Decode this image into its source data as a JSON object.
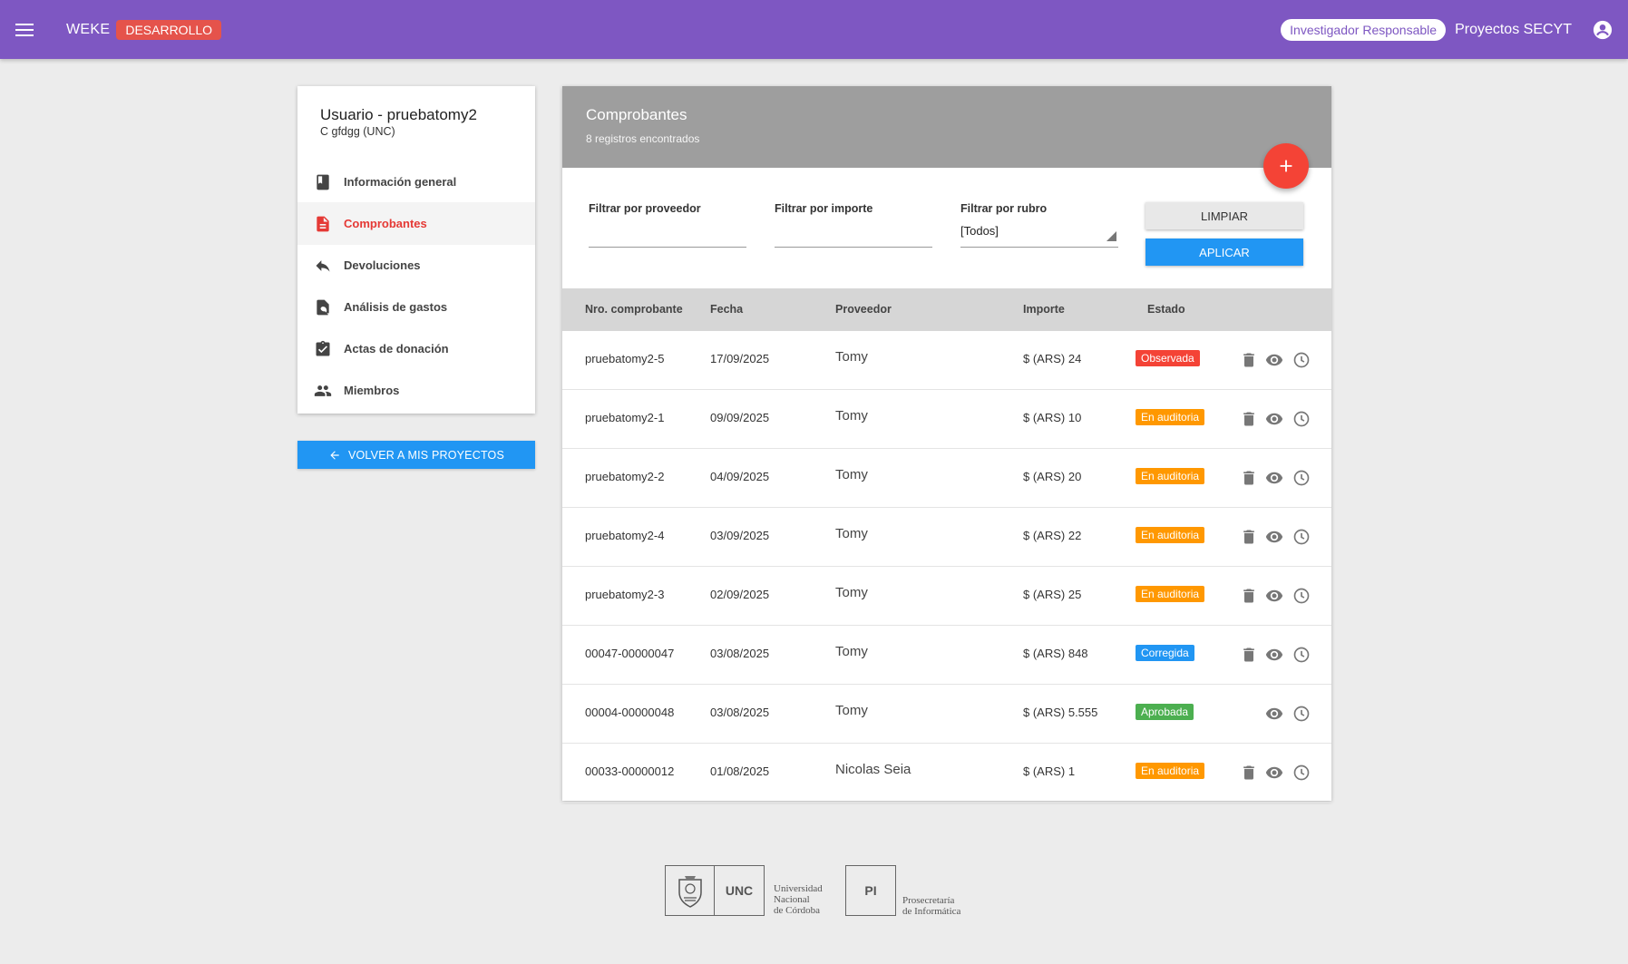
{
  "topbar": {
    "brand": "WEKE",
    "env": "DESARROLLO",
    "role": "Investigador Responsable",
    "projects": "Proyectos SECYT"
  },
  "sidebar": {
    "title": "Usuario - pruebatomy2",
    "subtitle": "C gfdgg (UNC)",
    "items": [
      {
        "label": "Información general",
        "icon": "book-icon"
      },
      {
        "label": "Comprobantes",
        "icon": "document-icon"
      },
      {
        "label": "Devoluciones",
        "icon": "reply-icon"
      },
      {
        "label": "Análisis de gastos",
        "icon": "find-in-page-icon"
      },
      {
        "label": "Actas de donación",
        "icon": "assignment-check-icon"
      },
      {
        "label": "Miembros",
        "icon": "people-icon"
      }
    ],
    "active": "Comprobantes",
    "back_label": "VOLVER A MIS PROYECTOS"
  },
  "main": {
    "title": "Comprobantes",
    "count": "8 registros encontrados",
    "filters": {
      "proveedor_label": "Filtrar por proveedor",
      "proveedor_value": "",
      "importe_label": "Filtrar por importe",
      "importe_value": "",
      "rubro_label": "Filtrar por rubro",
      "rubro_value": "[Todos]"
    },
    "clear_label": "LIMPIAR",
    "apply_label": "APLICAR",
    "columns": [
      "Nro. comprobante",
      "Fecha",
      "Proveedor",
      "Importe",
      "Estado"
    ],
    "rows": [
      {
        "nro": "pruebatomy2-5",
        "fecha": "17/09/2025",
        "proveedor": "Tomy",
        "importe": "$ (ARS) 24",
        "estado": "Observada",
        "delete": true
      },
      {
        "nro": "pruebatomy2-1",
        "fecha": "09/09/2025",
        "proveedor": "Tomy",
        "importe": "$ (ARS) 10",
        "estado": "En auditoria",
        "delete": true
      },
      {
        "nro": "pruebatomy2-2",
        "fecha": "04/09/2025",
        "proveedor": "Tomy",
        "importe": "$ (ARS) 20",
        "estado": "En auditoria",
        "delete": true
      },
      {
        "nro": "pruebatomy2-4",
        "fecha": "03/09/2025",
        "proveedor": "Tomy",
        "importe": "$ (ARS) 22",
        "estado": "En auditoria",
        "delete": true
      },
      {
        "nro": "pruebatomy2-3",
        "fecha": "02/09/2025",
        "proveedor": "Tomy",
        "importe": "$ (ARS) 25",
        "estado": "En auditoria",
        "delete": true
      },
      {
        "nro": "00047-00000047",
        "fecha": "03/08/2025",
        "proveedor": "Tomy",
        "importe": "$ (ARS) 848",
        "estado": "Corregida",
        "delete": true
      },
      {
        "nro": "00004-00000048",
        "fecha": "03/08/2025",
        "proveedor": "Tomy",
        "importe": "$ (ARS) 5.555",
        "estado": "Aprobada",
        "delete": false
      },
      {
        "nro": "00033-00000012",
        "fecha": "01/08/2025",
        "proveedor": "Nicolas Seia",
        "importe": "$ (ARS) 1",
        "estado": "En auditoria",
        "delete": true
      }
    ]
  },
  "status_colors": {
    "Observada": "#f44336",
    "En auditoria": "#ff9800",
    "Corregida": "#2196f3",
    "Aprobada": "#4caf50"
  },
  "colors": {
    "topbar": "#7e57c2",
    "accent": "#e53935",
    "primary": "#2196f3"
  },
  "footer": {
    "unc_abbr": "UNC",
    "unc_lines": [
      "Universidad",
      "Nacional",
      "de Córdoba"
    ],
    "pi_abbr": "PI",
    "pi_lines": [
      "Prosecretaría",
      "de Informática"
    ]
  }
}
